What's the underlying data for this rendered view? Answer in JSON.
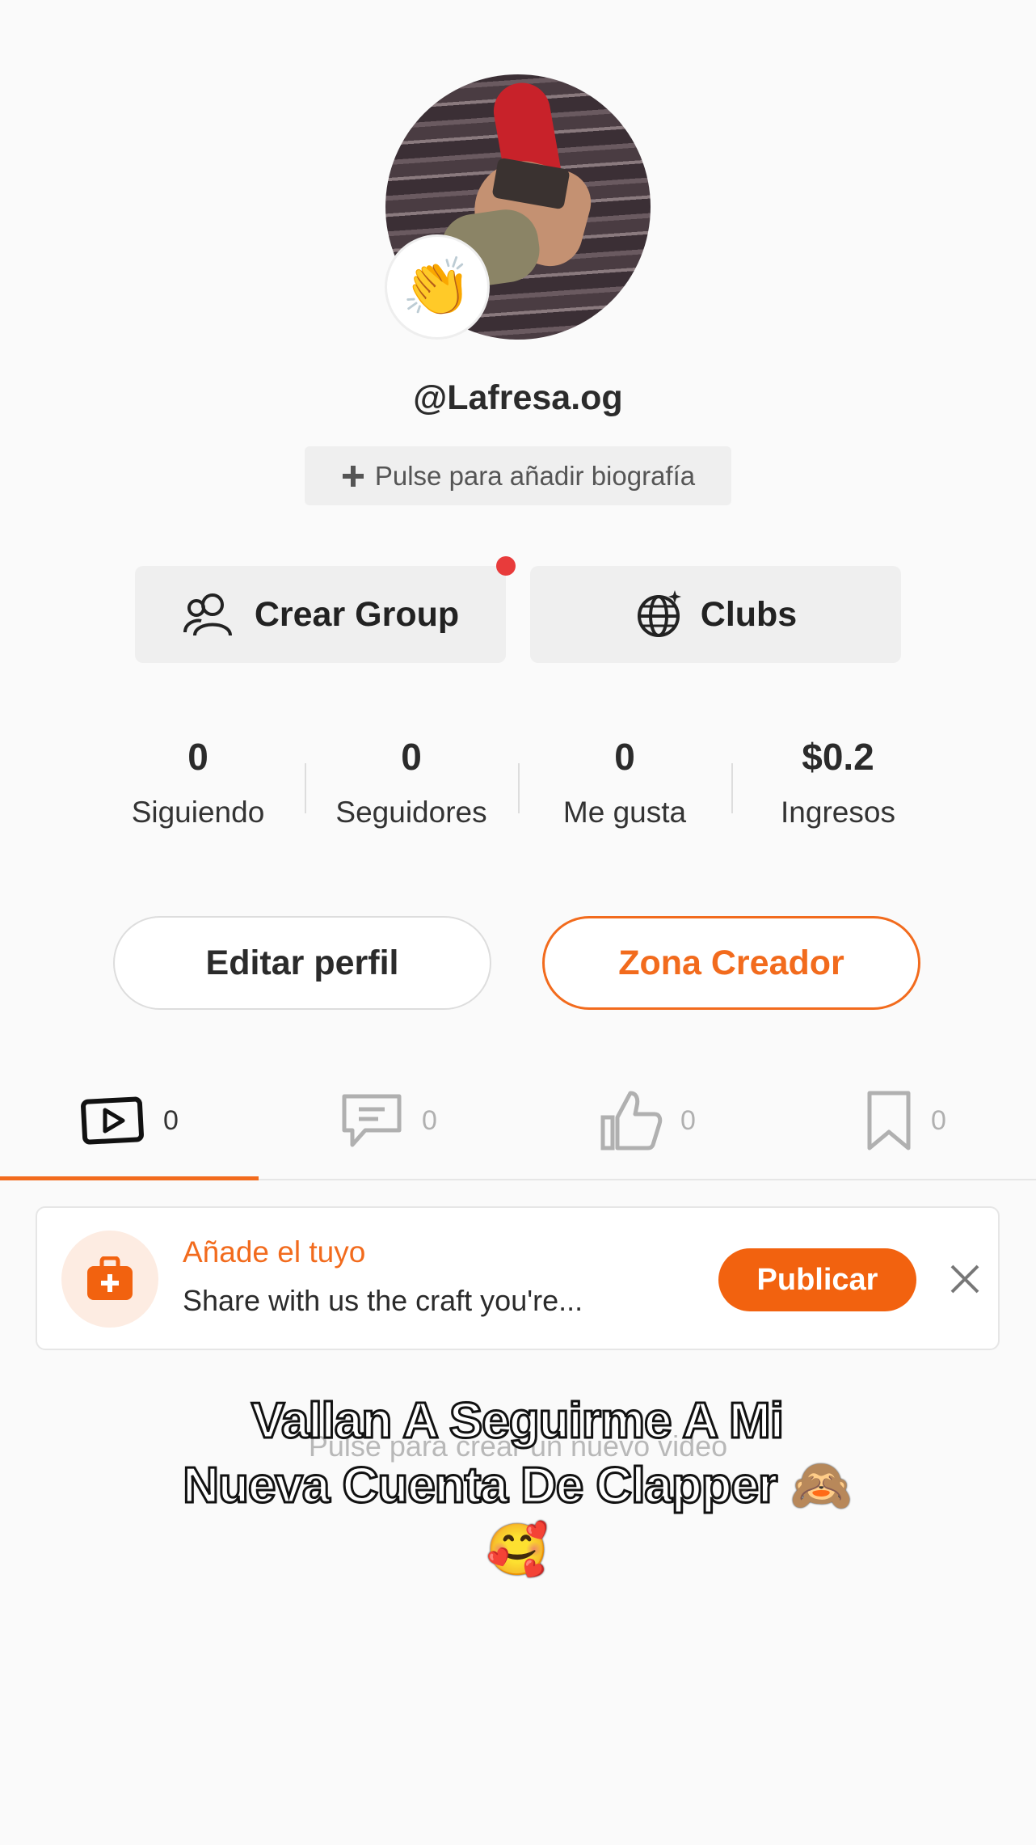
{
  "profile": {
    "username": "@Lafresa.og",
    "bio_prompt": "Pulse para añadir biografía",
    "badge_emoji": "👏"
  },
  "quick_actions": {
    "group_label": "Crear Group",
    "clubs_label": "Clubs"
  },
  "stats": [
    {
      "value": "0",
      "label": "Siguiendo"
    },
    {
      "value": "0",
      "label": "Seguidores"
    },
    {
      "value": "0",
      "label": "Me gusta"
    },
    {
      "value": "$0.2",
      "label": "Ingresos"
    }
  ],
  "buttons": {
    "edit_profile": "Editar perfil",
    "creator_zone": "Zona Creador"
  },
  "tabs": [
    {
      "icon": "video-icon",
      "count": "0"
    },
    {
      "icon": "comment-icon",
      "count": "0"
    },
    {
      "icon": "thumbs-up-icon",
      "count": "0"
    },
    {
      "icon": "bookmark-icon",
      "count": "0"
    }
  ],
  "promo": {
    "title": "Añade el tuyo",
    "subtitle": "Share with us the craft you're...",
    "publish_label": "Publicar"
  },
  "empty_hint": "Pulse para crear un nuevo video",
  "overlay_caption": {
    "line1": "Vallan A Seguirme A Mi",
    "line2": "Nueva Cuenta De Clapper 🙈",
    "line3": "🥰"
  },
  "colors": {
    "accent": "#f26b1d",
    "notification_dot": "#e83b3b"
  }
}
